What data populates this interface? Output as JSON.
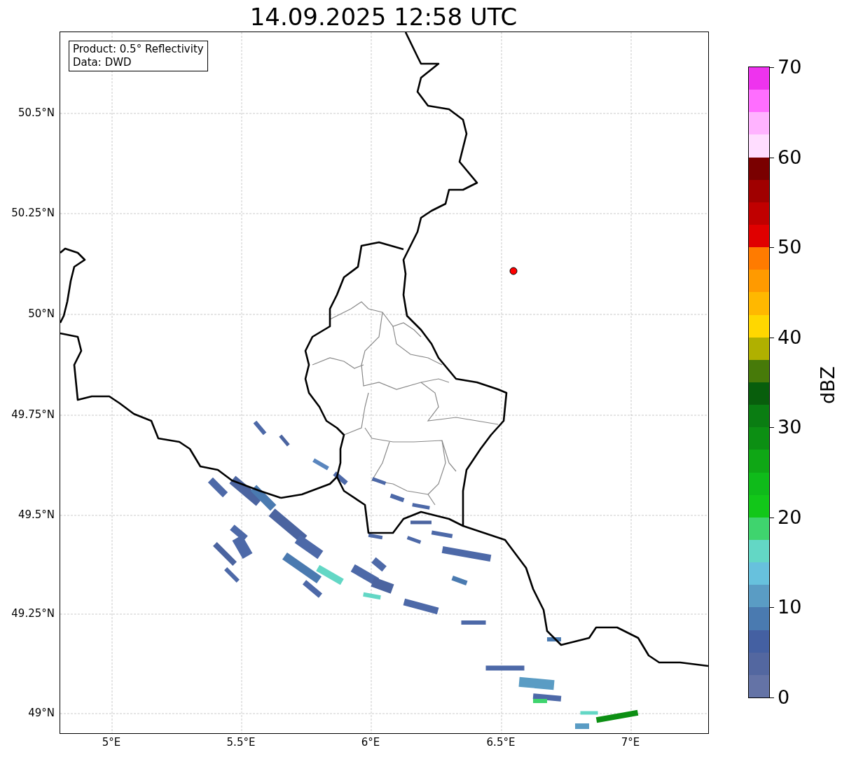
{
  "title": "14.09.2025 12:58 UTC",
  "info_box": {
    "lines": [
      "Product: 0.5° Reflectivity",
      "Data: DWD"
    ]
  },
  "map": {
    "xticks": [
      "5°E",
      "5.5°E",
      "6°E",
      "6.5°E",
      "7°E"
    ],
    "yticks": [
      "50.5°N",
      "50.25°N",
      "50°N",
      "49.75°N",
      "49.5°N",
      "49.25°N",
      "49°N"
    ]
  },
  "colorbar": {
    "label": "dBZ",
    "ticks": [
      "70",
      "60",
      "50",
      "40",
      "30",
      "20",
      "10",
      "0"
    ],
    "segments": [
      {
        "color": "#ee33ee"
      },
      {
        "color": "#ff6eff"
      },
      {
        "color": "#ffb3ff"
      },
      {
        "color": "#ffddff"
      },
      {
        "color": "#7a0000"
      },
      {
        "color": "#a00000"
      },
      {
        "color": "#c00000"
      },
      {
        "color": "#e00000"
      },
      {
        "color": "#ff7b00"
      },
      {
        "color": "#ff9a00"
      },
      {
        "color": "#ffb800"
      },
      {
        "color": "#ffd700"
      },
      {
        "color": "#b0b000"
      },
      {
        "color": "#477a09"
      },
      {
        "color": "#085e0c"
      },
      {
        "color": "#0a7d12"
      },
      {
        "color": "#0c8f13"
      },
      {
        "color": "#0fa715"
      },
      {
        "color": "#0fbb1a"
      },
      {
        "color": "#12c719"
      },
      {
        "color": "#3fd46e"
      },
      {
        "color": "#63d7c5"
      },
      {
        "color": "#67c1dd"
      },
      {
        "color": "#5a9cc4"
      },
      {
        "color": "#4a7ab0"
      },
      {
        "color": "#4460a2"
      },
      {
        "color": "#5367a0"
      },
      {
        "color": "#6473a6"
      }
    ]
  }
}
